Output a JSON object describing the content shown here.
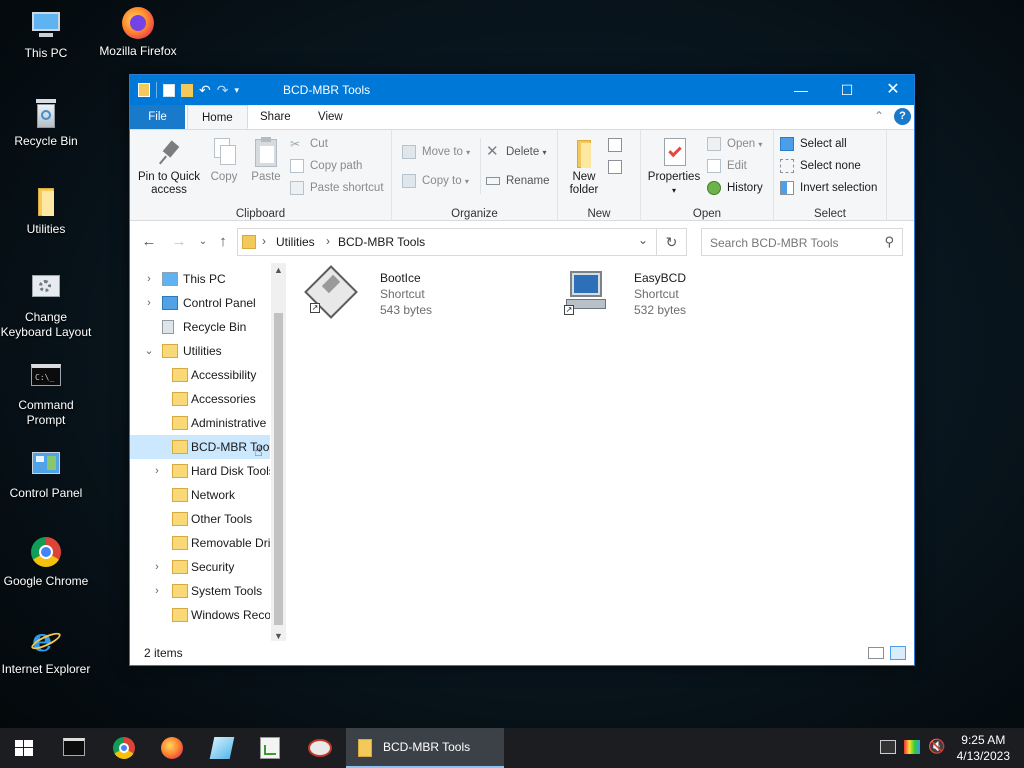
{
  "desktop": {
    "icons": [
      {
        "label": "This PC"
      },
      {
        "label": "Mozilla Firefox"
      },
      {
        "label": "Recycle Bin"
      },
      {
        "label": "Utilities"
      },
      {
        "label": "Change Keyboard Layout"
      },
      {
        "label": "Command Prompt"
      },
      {
        "label": "Control Panel"
      },
      {
        "label": "Google Chrome"
      },
      {
        "label": "Internet Explorer"
      }
    ]
  },
  "window": {
    "title": "BCD-MBR Tools",
    "tabs": {
      "file": "File",
      "home": "Home",
      "share": "Share",
      "view": "View"
    },
    "ribbon": {
      "clipboard": {
        "label": "Clipboard",
        "pin": "Pin to Quick access",
        "copy": "Copy",
        "paste": "Paste",
        "cut": "Cut",
        "copy_path": "Copy path",
        "paste_shortcut": "Paste shortcut"
      },
      "organize": {
        "label": "Organize",
        "move_to": "Move to",
        "copy_to": "Copy to",
        "delete": "Delete",
        "rename": "Rename"
      },
      "new": {
        "label": "New",
        "new_folder": "New folder"
      },
      "open": {
        "label": "Open",
        "properties": "Properties",
        "open": "Open",
        "edit": "Edit",
        "history": "History"
      },
      "select": {
        "label": "Select",
        "select_all": "Select all",
        "select_none": "Select none",
        "invert_selection": "Invert selection"
      }
    },
    "address": {
      "crumbs": [
        "Utilities",
        "BCD-MBR Tools"
      ]
    },
    "search": {
      "placeholder": "Search BCD-MBR Tools"
    },
    "tree": [
      {
        "label": "This PC"
      },
      {
        "label": "Control Panel"
      },
      {
        "label": "Recycle Bin"
      },
      {
        "label": "Utilities"
      },
      {
        "label": "Accessibility"
      },
      {
        "label": "Accessories"
      },
      {
        "label": "Administrative"
      },
      {
        "label": "BCD-MBR Tools"
      },
      {
        "label": "Hard Disk Tools"
      },
      {
        "label": "Network"
      },
      {
        "label": "Other Tools"
      },
      {
        "label": "Removable Drives"
      },
      {
        "label": "Security"
      },
      {
        "label": "System Tools"
      },
      {
        "label": "Windows Recovery"
      }
    ],
    "files": [
      {
        "name": "BootIce",
        "type": "Shortcut",
        "size": "543 bytes"
      },
      {
        "name": "EasyBCD",
        "type": "Shortcut",
        "size": "532 bytes"
      }
    ],
    "status": {
      "count": "2 items"
    }
  },
  "taskbar": {
    "active_window": "BCD-MBR Tools",
    "time": "9:25 AM",
    "date": "4/13/2023"
  }
}
